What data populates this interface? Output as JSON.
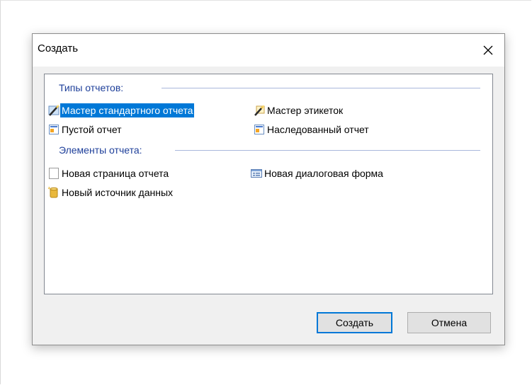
{
  "dialog": {
    "title": "Создать",
    "close_icon": "close-icon",
    "create_button": "Создать",
    "cancel_button": "Отмена"
  },
  "groups": {
    "report_types": {
      "header": "Типы отчетов:",
      "items": [
        {
          "label": "Мастер стандартного отчета",
          "icon": "wand-icon",
          "selected": true
        },
        {
          "label": "Мастер этикеток",
          "icon": "wand-icon",
          "selected": false
        },
        {
          "label": "Пустой отчет",
          "icon": "report-icon",
          "selected": false
        },
        {
          "label": "Наследованный отчет",
          "icon": "report-icon",
          "selected": false
        }
      ]
    },
    "report_elements": {
      "header": "Элементы отчета:",
      "items": [
        {
          "label": "Новая страница отчета",
          "icon": "page-icon"
        },
        {
          "label": "Новая диалоговая форма",
          "icon": "dialog-form-icon"
        },
        {
          "label": "Новый источник данных",
          "icon": "database-icon"
        }
      ]
    }
  },
  "colors": {
    "selection": "#0078d7",
    "group_header": "#1e3f9a",
    "dialog_bg": "#f0f0f0"
  }
}
